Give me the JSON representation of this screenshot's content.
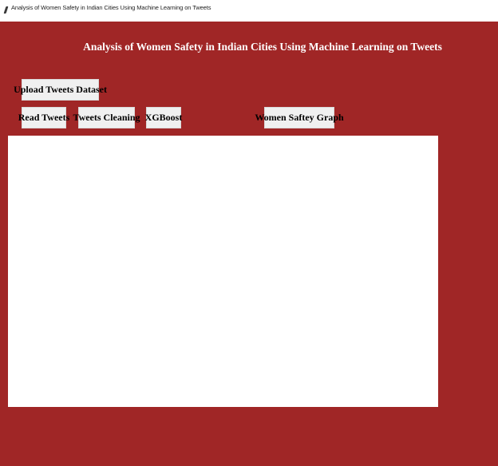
{
  "window": {
    "title": "Analysis of Women Safety in Indian Cities Using Machine Learning on Tweets",
    "icon": "feather-icon"
  },
  "main": {
    "heading": "Analysis of Women Safety in Indian Cities Using Machine Learning on Tweets",
    "background_color": "#a02626"
  },
  "buttons": {
    "upload": "Upload Tweets Dataset",
    "read": "Read Tweets",
    "cleaning": "Tweets Cleaning",
    "xgboost": "XGBoost",
    "graph": "Women Saftey Graph"
  },
  "output": {
    "value": ""
  }
}
